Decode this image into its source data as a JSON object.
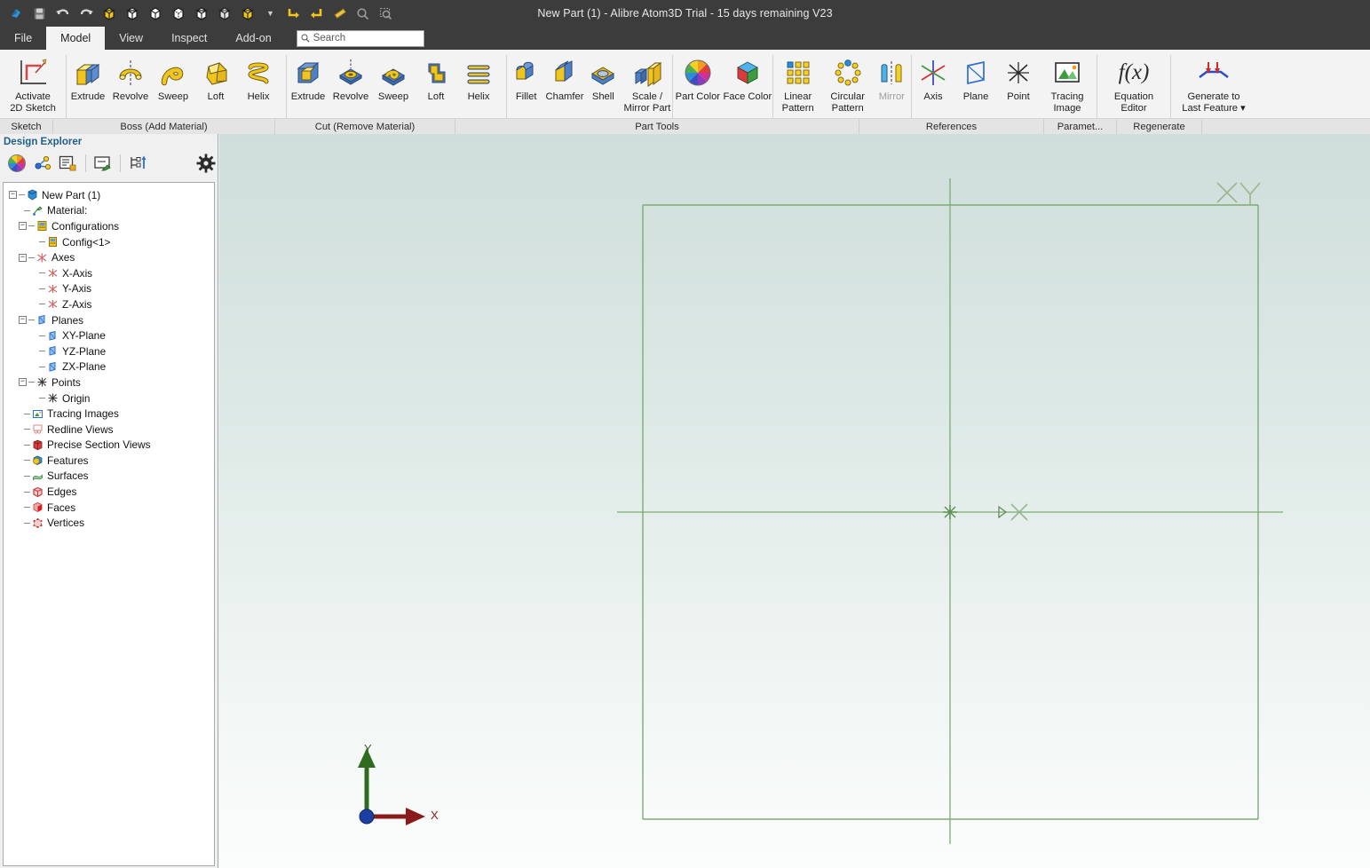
{
  "window": {
    "title": "New Part (1) - Alibre Atom3D  Trial - 15 days remaining V23"
  },
  "quick_access": {
    "items": [
      {
        "name": "alibre-logo-icon",
        "label": "Alibre"
      },
      {
        "name": "save-icon",
        "label": "Save"
      },
      {
        "name": "undo-icon",
        "label": "Undo"
      },
      {
        "name": "redo-icon",
        "label": "Redo"
      },
      {
        "name": "view-shaded-icon",
        "label": "Shaded"
      },
      {
        "name": "view-shaded-edges-icon",
        "label": "Shaded with Edges"
      },
      {
        "name": "view-wireframe-icon",
        "label": "Wireframe"
      },
      {
        "name": "view-hidden-line-icon",
        "label": "Hidden Line"
      },
      {
        "name": "view-hidden-line-removed-icon",
        "label": "Hidden Line Removed"
      },
      {
        "name": "view-transparent-icon",
        "label": "Transparent"
      },
      {
        "name": "view-realistic-icon",
        "label": "Realistic"
      },
      {
        "name": "chevron-down-icon",
        "label": "More"
      },
      {
        "name": "rotate-left-icon",
        "label": "Rotate Left"
      },
      {
        "name": "rotate-right-icon",
        "label": "Rotate Right"
      },
      {
        "name": "measure-icon",
        "label": "Measure"
      },
      {
        "name": "zoom-icon",
        "label": "Zoom"
      },
      {
        "name": "zoom-window-icon",
        "label": "Zoom Window"
      }
    ]
  },
  "menubar": {
    "tabs": [
      {
        "id": "file",
        "label": "File",
        "active": false
      },
      {
        "id": "model",
        "label": "Model",
        "active": true
      },
      {
        "id": "view",
        "label": "View",
        "active": false
      },
      {
        "id": "inspect",
        "label": "Inspect",
        "active": false
      },
      {
        "id": "addon",
        "label": "Add-on",
        "active": false
      }
    ],
    "search": {
      "value": "",
      "placeholder": "Search"
    }
  },
  "ribbon": {
    "groups": [
      {
        "id": "sketch",
        "label": "Sketch",
        "items": [
          {
            "icon": "activate-2d-sketch-icon",
            "label": "Activate\n2D Sketch",
            "size": "xwide",
            "enabled": true
          }
        ]
      },
      {
        "id": "boss",
        "label": "Boss (Add Material)",
        "items": [
          {
            "icon": "boss-extrude-icon",
            "label": "Extrude",
            "enabled": true
          },
          {
            "icon": "boss-revolve-icon",
            "label": "Revolve",
            "enabled": true
          },
          {
            "icon": "boss-sweep-icon",
            "label": "Sweep",
            "enabled": true
          },
          {
            "icon": "boss-loft-icon",
            "label": "Loft",
            "enabled": true
          },
          {
            "icon": "boss-helix-icon",
            "label": "Helix",
            "enabled": true
          }
        ]
      },
      {
        "id": "cut",
        "label": "Cut (Remove Material)",
        "items": [
          {
            "icon": "cut-extrude-icon",
            "label": "Extrude",
            "enabled": true
          },
          {
            "icon": "cut-revolve-icon",
            "label": "Revolve",
            "enabled": true
          },
          {
            "icon": "cut-sweep-icon",
            "label": "Sweep",
            "enabled": true
          },
          {
            "icon": "cut-loft-icon",
            "label": "Loft",
            "enabled": true
          },
          {
            "icon": "cut-helix-icon",
            "label": "Helix",
            "enabled": true
          }
        ]
      },
      {
        "id": "parttools",
        "label": "Part Tools",
        "items": [
          {
            "icon": "fillet-icon",
            "label": "Fillet",
            "enabled": true
          },
          {
            "icon": "chamfer-icon",
            "label": "Chamfer",
            "enabled": true
          },
          {
            "icon": "shell-icon",
            "label": "Shell",
            "enabled": true
          },
          {
            "icon": "scale-mirror-part-icon",
            "label": "Scale /\nMirror Part",
            "size": "wide",
            "enabled": true
          },
          {
            "icon": "part-color-icon",
            "label": "Part Color",
            "size": "wide",
            "enabled": true
          },
          {
            "icon": "face-color-icon",
            "label": "Face Color",
            "size": "wide",
            "enabled": true
          },
          {
            "icon": "linear-pattern-icon",
            "label": "Linear\nPattern",
            "size": "wide",
            "enabled": true
          },
          {
            "icon": "circular-pattern-icon",
            "label": "Circular\nPattern",
            "size": "wide",
            "enabled": true
          },
          {
            "icon": "mirror-icon",
            "label": "Mirror",
            "enabled": false
          }
        ]
      },
      {
        "id": "references",
        "label": "References",
        "items": [
          {
            "icon": "axis-icon",
            "label": "Axis",
            "enabled": true
          },
          {
            "icon": "plane-icon",
            "label": "Plane",
            "enabled": true
          },
          {
            "icon": "point-icon",
            "label": "Point",
            "enabled": true
          },
          {
            "icon": "tracing-image-icon",
            "label": "Tracing\nImage",
            "size": "wide",
            "enabled": true
          }
        ]
      },
      {
        "id": "parameters",
        "label": "Paramet...",
        "items": [
          {
            "icon": "equation-editor-icon",
            "label": "Equation\nEditor",
            "size": "wide",
            "enabled": true
          }
        ]
      },
      {
        "id": "regenerate",
        "label": "Regenerate",
        "items": [
          {
            "icon": "generate-to-last-feature-icon",
            "label": "Generate to\nLast Feature ▾",
            "size": "xwide",
            "enabled": true
          }
        ]
      }
    ]
  },
  "design_explorer": {
    "title": "Design Explorer",
    "toolbar": [
      {
        "name": "part-color-tool-icon",
        "label": "Part Color"
      },
      {
        "name": "node-graph-tool-icon",
        "label": "Relations"
      },
      {
        "name": "properties-tool-icon",
        "label": "Properties"
      },
      {
        "name": "rename-tool-icon",
        "label": "Rename"
      },
      {
        "name": "reorder-tree-tool-icon",
        "label": "Reorder"
      },
      {
        "name": "settings-gear-icon",
        "label": "Options"
      }
    ],
    "tree": [
      {
        "label": "New Part (1)",
        "depth": 0,
        "toggle": "minus",
        "icon": "part-icon"
      },
      {
        "label": "Material:",
        "depth": 1,
        "toggle": "none",
        "icon": "material-icon"
      },
      {
        "label": "Configurations",
        "depth": 1,
        "toggle": "minus",
        "icon": "configurations-icon"
      },
      {
        "label": "Config<1>",
        "depth": 2,
        "toggle": "none",
        "icon": "config-icon"
      },
      {
        "label": "Axes",
        "depth": 1,
        "toggle": "minus",
        "icon": "axes-icon"
      },
      {
        "label": "X-Axis",
        "depth": 2,
        "toggle": "none",
        "icon": "axis-item-icon"
      },
      {
        "label": "Y-Axis",
        "depth": 2,
        "toggle": "none",
        "icon": "axis-item-icon"
      },
      {
        "label": "Z-Axis",
        "depth": 2,
        "toggle": "none",
        "icon": "axis-item-icon"
      },
      {
        "label": "Planes",
        "depth": 1,
        "toggle": "minus",
        "icon": "planes-icon"
      },
      {
        "label": "XY-Plane",
        "depth": 2,
        "toggle": "none",
        "icon": "plane-item-icon"
      },
      {
        "label": "YZ-Plane",
        "depth": 2,
        "toggle": "none",
        "icon": "plane-item-icon"
      },
      {
        "label": "ZX-Plane",
        "depth": 2,
        "toggle": "none",
        "icon": "plane-item-icon"
      },
      {
        "label": "Points",
        "depth": 1,
        "toggle": "minus",
        "icon": "points-icon"
      },
      {
        "label": "Origin",
        "depth": 2,
        "toggle": "none",
        "icon": "origin-icon"
      },
      {
        "label": "Tracing Images",
        "depth": 1,
        "toggle": "none",
        "icon": "tracing-images-icon"
      },
      {
        "label": "Redline Views",
        "depth": 1,
        "toggle": "none",
        "icon": "redline-views-icon"
      },
      {
        "label": "Precise Section Views",
        "depth": 1,
        "toggle": "none",
        "icon": "section-views-icon"
      },
      {
        "label": "Features",
        "depth": 1,
        "toggle": "none",
        "icon": "features-icon"
      },
      {
        "label": "Surfaces",
        "depth": 1,
        "toggle": "none",
        "icon": "surfaces-icon"
      },
      {
        "label": "Edges",
        "depth": 1,
        "toggle": "none",
        "icon": "edges-icon"
      },
      {
        "label": "Faces",
        "depth": 1,
        "toggle": "none",
        "icon": "faces-icon"
      },
      {
        "label": "Vertices",
        "depth": 1,
        "toggle": "none",
        "icon": "vertices-icon"
      }
    ]
  },
  "viewport": {
    "triad": {
      "x_label": "X",
      "y_label": "Y",
      "x_color": "#8b1a1a",
      "y_color": "#2f6b1f",
      "origin_color": "#1d3fa0"
    },
    "sketch_color": "#7faa74",
    "background_top": "#cfdedb",
    "background_bottom": "#fbfdfc"
  }
}
